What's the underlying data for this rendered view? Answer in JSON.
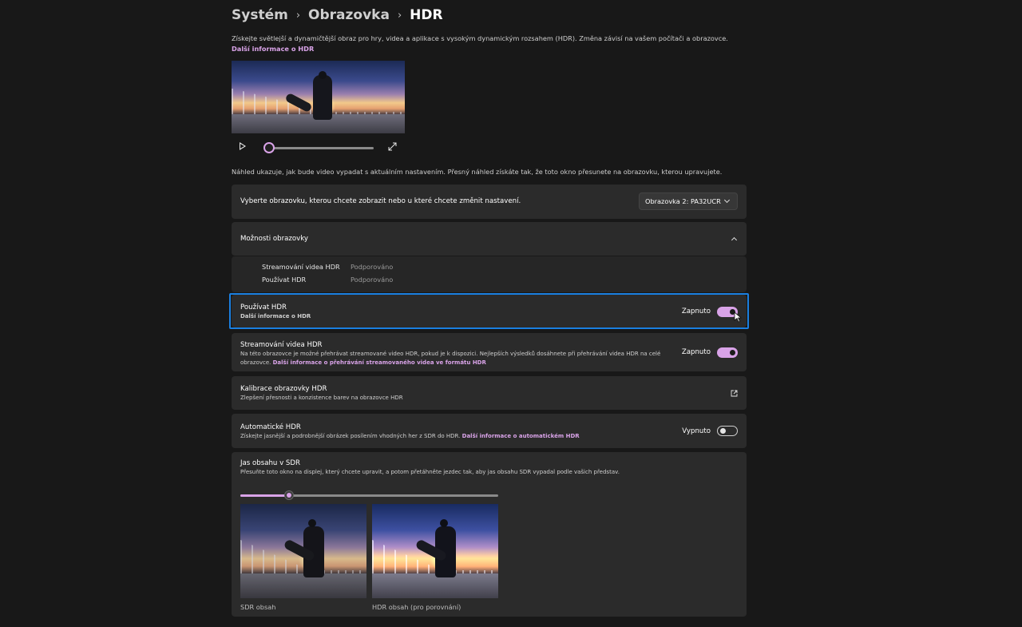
{
  "breadcrumb": {
    "level1": "Systém",
    "level2": "Obrazovka",
    "current": "HDR"
  },
  "intro": {
    "text": "Získejte světlejší a dynamičtější obraz pro hry, videa a aplikace s vysokým dynamickým rozsahem (HDR). Změna závisí na vašem počítači a obrazovce.",
    "link": "Další informace o HDR"
  },
  "video": {
    "play_icon": "play-icon",
    "expand_icon": "expand-icon",
    "progress": 0.0
  },
  "preview_note": "Náhled ukazuje, jak bude video vypadat s aktuálním nastavením. Přesný náhled získáte tak, že toto okno přesunete na obrazovku, kterou upravujete.",
  "display_select": {
    "label": "Vyberte obrazovku, kterou chcete zobrazit nebo u které chcete změnit nastavení.",
    "value": "Obrazovka 2: PA32UCR"
  },
  "display_options": {
    "title": "Možnosti obrazovky",
    "rows": [
      {
        "label": "Streamování videa HDR",
        "value": "Podporováno"
      },
      {
        "label": "Používat HDR",
        "value": "Podporováno"
      }
    ]
  },
  "use_hdr": {
    "title": "Používat HDR",
    "link": "Další informace o HDR",
    "state": "Zapnuto",
    "on": true
  },
  "streaming": {
    "title": "Streamování videa HDR",
    "desc": "Na této obrazovce je možné přehrávat streamované video HDR, pokud je k dispozici. Nejlepších výsledků dosáhnete při přehrávání videa HDR na celé obrazovce.",
    "link": "Další informace o přehrávání streamovaného videa ve formátu HDR",
    "state": "Zapnuto",
    "on": true
  },
  "calibration": {
    "title": "Kalibrace obrazovky HDR",
    "desc": "Zlepšení přesnosti a konzistence barev na obrazovce HDR",
    "icon": "external-link-icon"
  },
  "auto_hdr": {
    "title": "Automatické HDR",
    "desc": "Získejte jasnější a podrobnější obrázek posílením vhodných her z SDR do HDR.",
    "link": "Další informace o automatickém HDR",
    "state": "Vypnuto",
    "on": false
  },
  "sdr_brightness": {
    "title": "Jas obsahu v SDR",
    "desc": "Přesuňte toto okno na displej, který chcete upravit, a potom přetáhněte jezdec tak, aby jas obsahu SDR vypadal podle vašich představ.",
    "slider_fraction": 0.19,
    "sdr_label": "SDR obsah",
    "hdr_label": "HDR obsah (pro porovnání)"
  },
  "colors": {
    "accent": "#d9a3e8",
    "focus": "#1a7fe0",
    "background": "#181818",
    "card": "#2b2b2b"
  }
}
